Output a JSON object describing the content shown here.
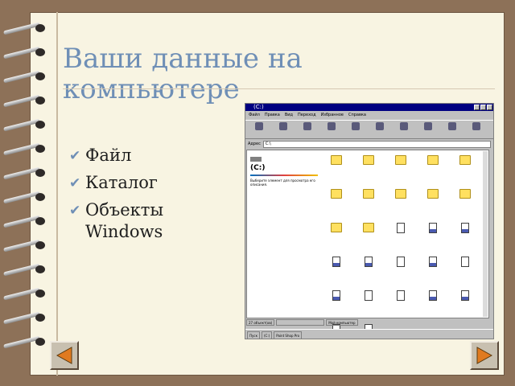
{
  "slide": {
    "title": "Ваши данные на компьютере",
    "bullets": [
      "Файл",
      "Каталог",
      "Объекты Windows"
    ],
    "bullet_icon": "checkmark-icon"
  },
  "explorer": {
    "title": "(C:)",
    "menu": [
      "Файл",
      "Правка",
      "Вид",
      "Переход",
      "Избранное",
      "Справка"
    ],
    "address_label": "Адрес",
    "address_value": "C:\\",
    "drive_label": "(C:)",
    "drive_desc": "Выберите элемент для просмотра его описания.",
    "status": [
      "27 объект(ов)",
      "",
      "Мой компьютер"
    ],
    "taskbar": [
      "Пуск",
      "(C:)",
      "Paint Shop Pro"
    ]
  },
  "nav": {
    "prev_icon": "triangle-left-icon",
    "next_icon": "triangle-right-icon",
    "accent": "#e07a20"
  }
}
